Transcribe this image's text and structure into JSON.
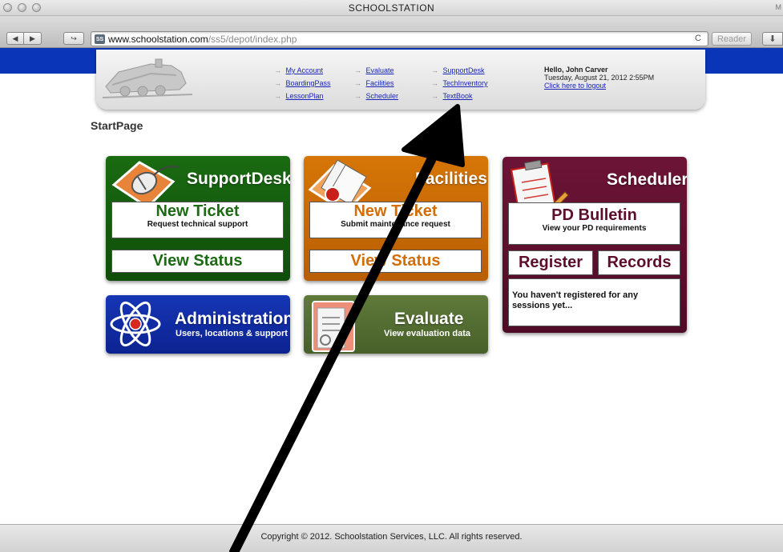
{
  "window": {
    "title": "SCHOOLSTATION",
    "corner_mark": "M"
  },
  "toolbar": {
    "back_icon": "◀",
    "forward_icon": "▶",
    "share_icon": "↪",
    "favicon_text": "SS",
    "url_host": "www.schoolstation.com",
    "url_path": "/ss5/depot/index.php",
    "reload_icon": "C",
    "reader_label": "Reader",
    "download_icon": "⬇"
  },
  "header": {
    "nav_col1": [
      "My Account",
      "BoardingPass",
      "LessonPlan"
    ],
    "nav_col2": [
      "Evaluate",
      "Facilities",
      "Scheduler"
    ],
    "nav_col3": [
      "SupportDesk",
      "TechInventory",
      "TextBook"
    ],
    "greeting": "Hello, John Carver",
    "datetime": "Tuesday, August 21, 2012 2:55PM",
    "logout_link": "Click here to logout"
  },
  "page": {
    "heading": "StartPage"
  },
  "tiles": {
    "support": {
      "title": "SupportDesk",
      "primary": "New Ticket",
      "primary_sub": "Request technical support",
      "secondary": "View Status"
    },
    "facilities": {
      "title": "Facilities",
      "primary": "New Ticket",
      "primary_sub": "Submit maintenance request",
      "secondary": "View Status"
    },
    "scheduler": {
      "title": "Scheduler",
      "primary": "PD Bulletin",
      "primary_sub": "View your PD requirements",
      "btn_register": "Register",
      "btn_records": "Records",
      "message": "You haven't registered for any sessions yet..."
    },
    "admin": {
      "title": "Administration",
      "subtitle": "Users, locations & support"
    },
    "evaluate": {
      "title": "Evaluate",
      "subtitle": "View evaluation data"
    }
  },
  "footer": {
    "text": "Copyright © 2012. Schoolstation Services, LLC. All rights reserved."
  },
  "colors": {
    "blue_bar": "#0a35b8",
    "support": "#1a6b12",
    "facilities": "#d67607",
    "scheduler": "#6d1436",
    "admin": "#1636b5",
    "evaluate": "#5f7a3a",
    "link": "#1a24b8"
  }
}
